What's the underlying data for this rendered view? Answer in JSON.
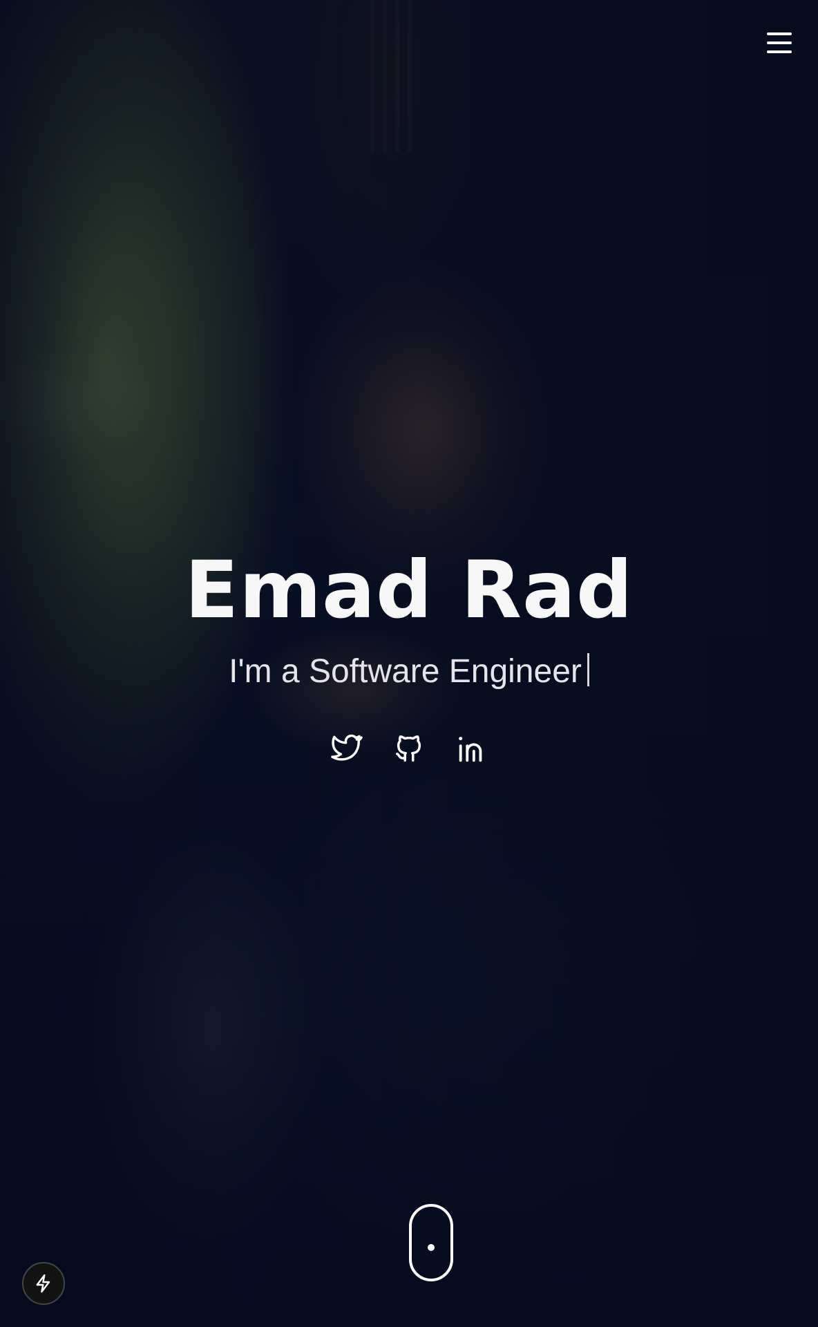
{
  "hero": {
    "name": "Emad Rad",
    "tagline": "I'm a Software Engineer"
  },
  "header": {
    "menu_icon": "hamburger-menu-icon"
  },
  "socials": [
    {
      "icon": "twitter-icon"
    },
    {
      "icon": "github-icon"
    },
    {
      "icon": "linkedin-icon"
    }
  ],
  "scroll_indicator": {
    "icon": "mouse-scroll-icon"
  },
  "fab": {
    "icon": "lightning-bolt-icon"
  },
  "colors": {
    "text": "#ffffff",
    "background": "#060b1c",
    "fab_background": "#121212"
  }
}
